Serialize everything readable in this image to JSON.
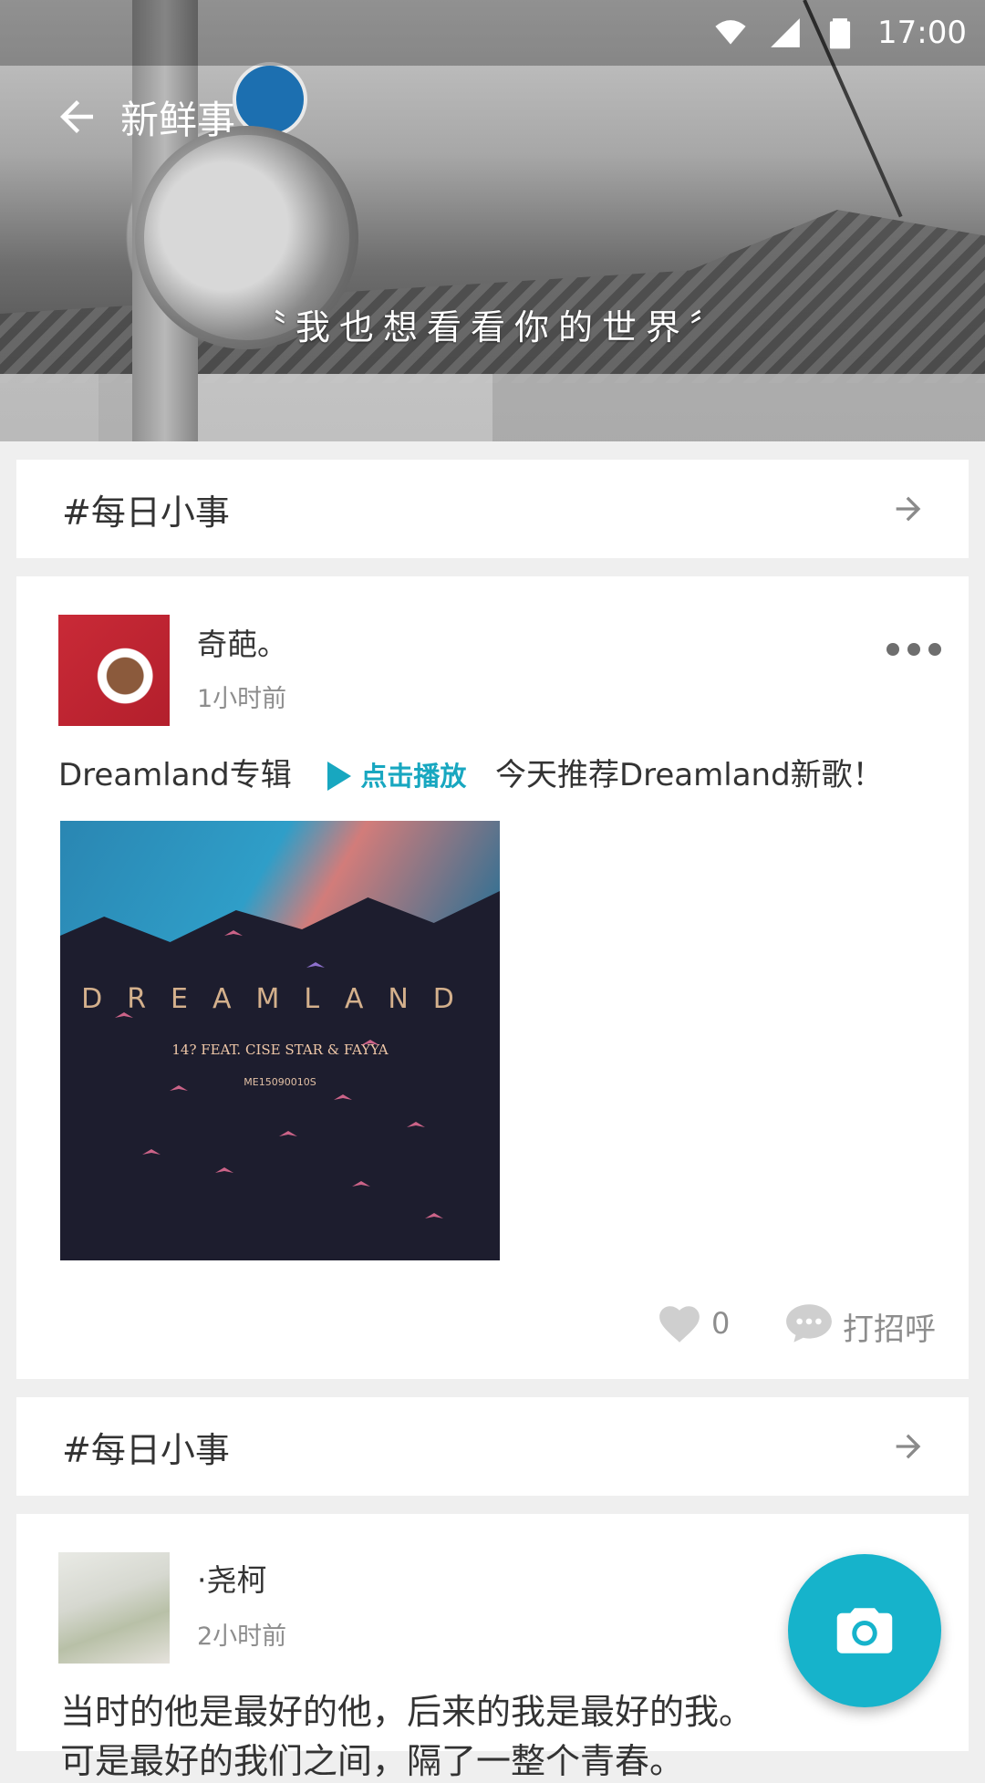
{
  "status_bar": {
    "time": "17:00",
    "icons": [
      "wifi-icon",
      "signal-icon",
      "battery-icon"
    ]
  },
  "toolbar": {
    "title": "新鲜事",
    "back_icon": "arrow-left-icon"
  },
  "hero": {
    "quote": "〝我也想看看你的世界〞"
  },
  "topics": [
    {
      "title": "#每日小事",
      "icon": "arrow-right-icon"
    },
    {
      "title": "#每日小事",
      "icon": "arrow-right-icon"
    }
  ],
  "posts": [
    {
      "user": "奇葩。",
      "time": "1小时前",
      "album_label": "Dreamland专辑",
      "play_label": "点击播放",
      "text": "今天推荐Dreamland新歌！",
      "album": {
        "title": "DREAMLAND",
        "feat": "14? FEAT. CISE STAR & FAYYA",
        "code": "ME15090010S"
      },
      "likes": "0",
      "greet_label": "打招呼"
    },
    {
      "user": "·尧柯",
      "time": "2小时前",
      "text_line1": "当时的他是最好的他，后来的我是最好的我。",
      "text_line2": "可是最好的我们之间，隔了一整个青春。"
    }
  ],
  "fab": {
    "icon": "camera-icon"
  },
  "colors": {
    "accent": "#16b3cb",
    "link": "#18a7c0",
    "background": "#efefef"
  }
}
